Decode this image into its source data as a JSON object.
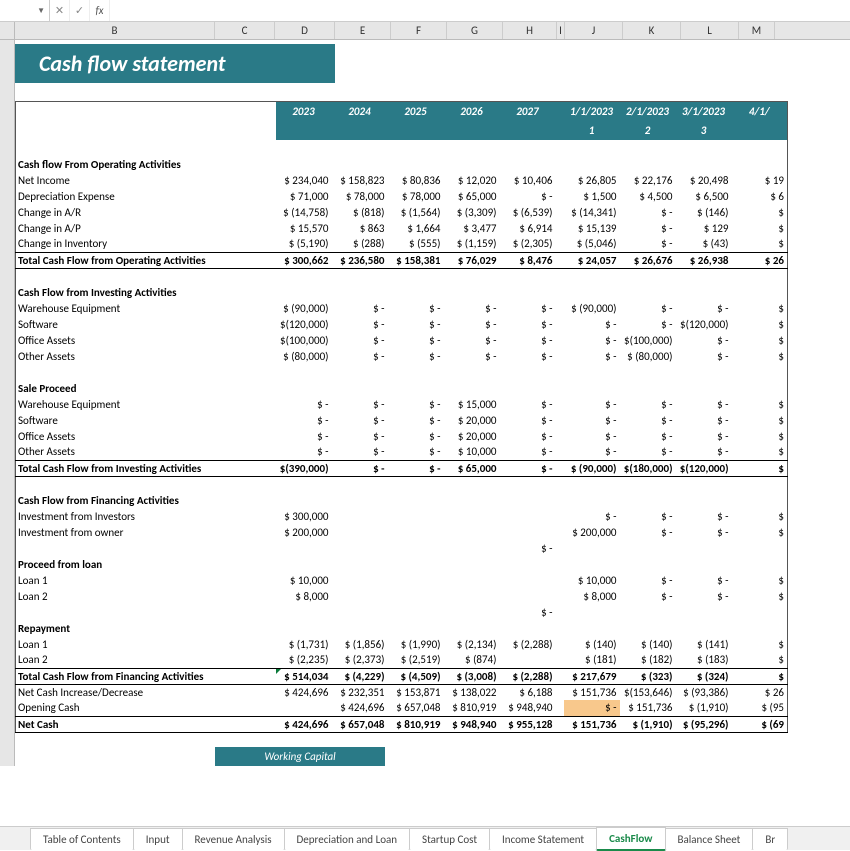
{
  "cols": [
    "B",
    "C",
    "D",
    "E",
    "F",
    "G",
    "H",
    "I",
    "J",
    "K",
    "L",
    "M"
  ],
  "title": "Cash flow statement",
  "years": [
    "2023",
    "2024",
    "2025",
    "2026",
    "2027"
  ],
  "months": {
    "dates": [
      "1/1/2023",
      "2/1/2023",
      "3/1/2023",
      "4/1/"
    ],
    "nums": [
      "1",
      "2",
      "3"
    ]
  },
  "sections": {
    "op_title": "Cash flow From Operating Activities",
    "op_rows": [
      {
        "l": "Net Income",
        "y": [
          "$ 234,040",
          "$ 158,823",
          "$   80,836",
          "$   12,020",
          "$   10,406"
        ],
        "m": [
          "$   26,805",
          "$   22,176",
          "$   20,498",
          "$  19"
        ]
      },
      {
        "l": "Depreciation Expense",
        "y": [
          "$   71,000",
          "$   78,000",
          "$   78,000",
          "$   65,000",
          "$        -"
        ],
        "m": [
          "$     1,500",
          "$     4,500",
          "$     6,500",
          "$    6"
        ]
      },
      {
        "l": "Change in A/R",
        "y": [
          "$  (14,758)",
          "$      (818)",
          "$   (1,564)",
          "$   (3,309)",
          "$   (6,539)"
        ],
        "m": [
          "$ (14,341)",
          "$        -",
          "$      (146)",
          "$"
        ]
      },
      {
        "l": "Change in A/P",
        "y": [
          "$   15,570",
          "$       863",
          "$    1,664",
          "$    3,477",
          "$    6,914"
        ],
        "m": [
          "$   15,139",
          "$        -",
          "$       129",
          "$"
        ]
      },
      {
        "l": "Change in Inventory",
        "y": [
          "$   (5,190)",
          "$      (288)",
          "$      (555)",
          "$   (1,159)",
          "$   (2,305)"
        ],
        "m": [
          "$   (5,046)",
          "$        -",
          "$        (43)",
          "$"
        ]
      }
    ],
    "op_total": {
      "l": "Total Cash Flow from  Operating Activities",
      "y": [
        "$ 300,662",
        "$ 236,580",
        "$ 158,381",
        "$   76,029",
        "$    8,476"
      ],
      "m": [
        "$   24,057",
        "$   26,676",
        "$   26,938",
        "$  26"
      ]
    },
    "inv_title": "Cash Flow from Investing Activities",
    "inv_rows": [
      {
        "l": "Warehouse Equipment",
        "y": [
          "$  (90,000)",
          "$        -",
          "$        -",
          "$        -",
          "$        -"
        ],
        "m": [
          "$ (90,000)",
          "$        -",
          "$        -",
          "$"
        ]
      },
      {
        "l": "Software",
        "y": [
          "$(120,000)",
          "$        -",
          "$        -",
          "$        -",
          "$        -"
        ],
        "m": [
          "$        -",
          "$        -",
          "$(120,000)",
          "$"
        ]
      },
      {
        "l": "Office Assets",
        "y": [
          "$(100,000)",
          "$        -",
          "$        -",
          "$        -",
          "$        -"
        ],
        "m": [
          "$        -",
          "$(100,000)",
          "$        -",
          "$"
        ]
      },
      {
        "l": "Other Assets",
        "y": [
          "$  (80,000)",
          "$        -",
          "$        -",
          "$        -",
          "$        -"
        ],
        "m": [
          "$        -",
          "$ (80,000)",
          "$        -",
          "$"
        ]
      }
    ],
    "sale_title": "Sale Proceed",
    "sale_rows": [
      {
        "l": "Warehouse Equipment",
        "y": [
          "$        -",
          "$        -",
          "$        -",
          "$   15,000",
          "$        -"
        ],
        "m": [
          "$        -",
          "$        -",
          "$        -",
          "$"
        ]
      },
      {
        "l": "Software",
        "y": [
          "$        -",
          "$        -",
          "$        -",
          "$   20,000",
          "$        -"
        ],
        "m": [
          "$        -",
          "$        -",
          "$        -",
          "$"
        ]
      },
      {
        "l": "Office Assets",
        "y": [
          "$        -",
          "$        -",
          "$        -",
          "$   20,000",
          "$        -"
        ],
        "m": [
          "$        -",
          "$        -",
          "$        -",
          "$"
        ]
      },
      {
        "l": "Other Assets",
        "y": [
          "$        -",
          "$        -",
          "$        -",
          "$   10,000",
          "$        -"
        ],
        "m": [
          "$        -",
          "$        -",
          "$        -",
          "$"
        ]
      }
    ],
    "inv_total": {
      "l": "Total Cash Flow from Investing Activities",
      "y": [
        "$(390,000)",
        "$        -",
        "$        -",
        "$   65,000",
        "$        -"
      ],
      "m": [
        "$ (90,000)",
        "$(180,000)",
        "$(120,000)",
        "$"
      ]
    },
    "fin_title": "Cash Flow from Financing Activities",
    "fin_rows": [
      {
        "l": "Investment from Investors",
        "y": [
          "$ 300,000",
          "",
          "",
          "",
          ""
        ],
        "m": [
          "$        -",
          "$        -",
          "$        -",
          "$"
        ]
      },
      {
        "l": "Investment from owner",
        "y": [
          "$ 200,000",
          "",
          "",
          "",
          ""
        ],
        "m": [
          "$ 200,000",
          "$        -",
          "$        -",
          "$"
        ]
      },
      {
        "l": "",
        "y": [
          "",
          "",
          "",
          "",
          "$        -"
        ],
        "m": [
          "",
          "",
          "",
          ""
        ]
      }
    ],
    "loan_title": "Proceed from loan",
    "loan_rows": [
      {
        "l": "Loan 1",
        "y": [
          "$   10,000",
          "",
          "",
          "",
          ""
        ],
        "m": [
          "$   10,000",
          "$        -",
          "$        -",
          "$"
        ]
      },
      {
        "l": "Loan 2",
        "y": [
          "$     8,000",
          "",
          "",
          "",
          ""
        ],
        "m": [
          "$     8,000",
          "$        -",
          "$        -",
          "$"
        ]
      },
      {
        "l": "",
        "y": [
          "",
          "",
          "",
          "",
          "$        -"
        ],
        "m": [
          "",
          "",
          "",
          ""
        ]
      }
    ],
    "repay_title": "Repayment",
    "repay_rows": [
      {
        "l": "Loan 1",
        "y": [
          "$   (1,731)",
          "$   (1,856)",
          "$   (1,990)",
          "$   (2,134)",
          "$   (2,288)"
        ],
        "m": [
          "$      (140)",
          "$      (140)",
          "$      (141)",
          "$"
        ]
      },
      {
        "l": "Loan 2",
        "y": [
          "$   (2,235)",
          "$   (2,373)",
          "$   (2,519)",
          "$      (874)",
          ""
        ],
        "m": [
          "$      (181)",
          "$      (182)",
          "$      (183)",
          "$"
        ]
      }
    ],
    "fin_total": {
      "l": "Total Cash Flow from Financing Activities",
      "y": [
        "$ 514,034",
        "$   (4,229)",
        "$   (4,509)",
        "$   (3,008)",
        "$   (2,288)"
      ],
      "m": [
        "$ 217,679",
        "$      (323)",
        "$      (324)",
        "$"
      ]
    },
    "netinc": {
      "l": "Net Cash Increase/Decrease",
      "y": [
        "$ 424,696",
        "$ 232,351",
        "$ 153,871",
        "$ 138,022",
        "$    6,188"
      ],
      "m": [
        "$ 151,736",
        "$(153,646)",
        "$ (93,386)",
        "$  26"
      ]
    },
    "open": {
      "l": "Opening Cash",
      "y": [
        "",
        "$ 424,696",
        "$ 657,048",
        "$ 810,919",
        "$ 948,940"
      ],
      "m": [
        "$        -",
        "$ 151,736",
        "$   (1,910)",
        "$ (95"
      ]
    },
    "net": {
      "l": "Net Cash",
      "y": [
        "$ 424,696",
        "$ 657,048",
        "$ 810,919",
        "$ 948,940",
        "$ 955,128"
      ],
      "m": [
        "$ 151,736",
        "$   (1,910)",
        "$ (95,296)",
        "$ (69"
      ]
    }
  },
  "wc": "Working Capital",
  "tabs": [
    "Table of Contents",
    "Input",
    "Revenue Analysis",
    "Depreciation and Loan",
    "Startup Cost",
    "Income Statement",
    "CashFlow",
    "Balance Sheet",
    "Br"
  ]
}
